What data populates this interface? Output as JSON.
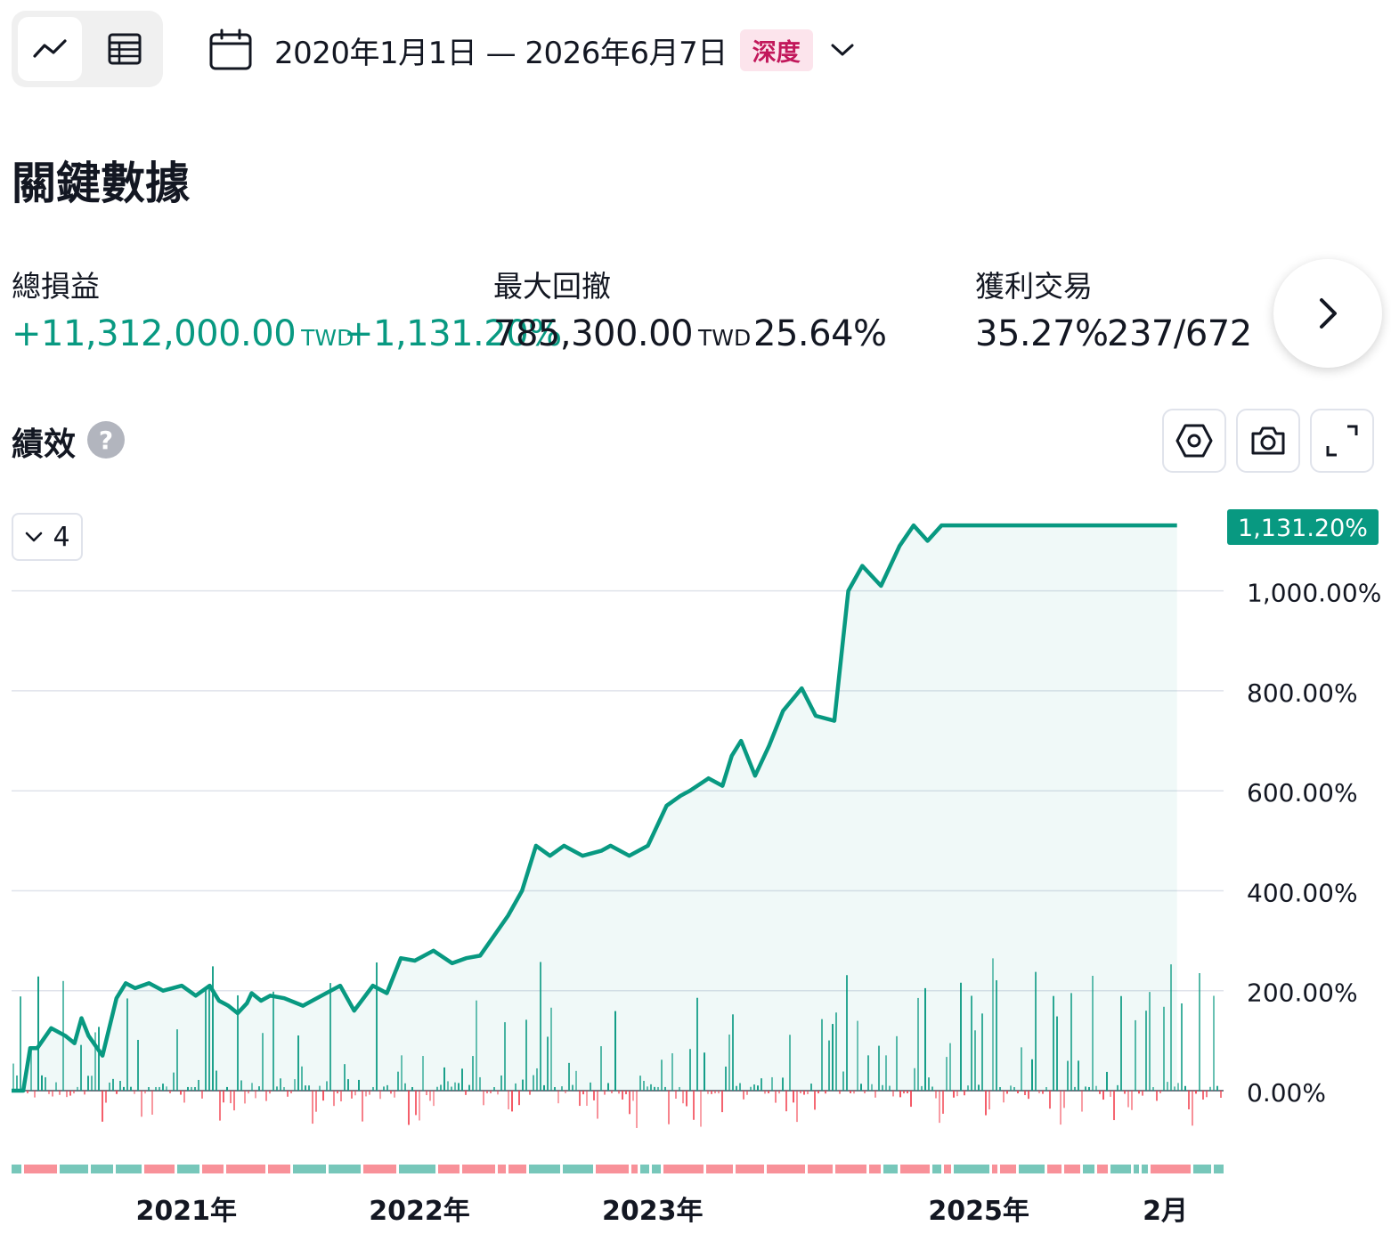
{
  "toolbar": {
    "view_modes": [
      "chart-view",
      "table-view"
    ],
    "date_range": "2020年1月1日 — 2026年6月7日",
    "badge": "深度"
  },
  "section_title": "關鍵數據",
  "metrics": {
    "total_pnl": {
      "label": "總損益",
      "value": "+11,312,000.00",
      "unit": "TWD",
      "percent": "+1,131.20%"
    },
    "max_drawdown": {
      "label": "最大回撤",
      "value": "785,300.00",
      "unit": "TWD",
      "percent": "25.64%"
    },
    "profitable_trades": {
      "label": "獲利交易",
      "percent": "35.27%",
      "ratio": "237/672"
    }
  },
  "performance": {
    "title": "績效",
    "help": "?",
    "series_count": "4"
  },
  "colors": {
    "accent": "#089981",
    "loss": "#f23645",
    "badge_bg": "#fce4ec",
    "badge_fg": "#c2185b",
    "grid": "#e0e3eb"
  },
  "chart_data": {
    "type": "line",
    "current_label": "1,131.20%",
    "y_tick_labels": [
      "1,000.00%",
      "800.00%",
      "600.00%",
      "400.00%",
      "200.00%",
      "0.00%"
    ],
    "y_ticks": [
      1000,
      800,
      600,
      400,
      200,
      0
    ],
    "ylim": [
      0,
      1131.2
    ],
    "x_tick_labels": [
      "2021年",
      "2022年",
      "2023年",
      "2025年",
      "2月"
    ],
    "x_ticks": [
      2021.0,
      2022.0,
      2023.0,
      2024.4,
      2025.2
    ],
    "xlim": [
      2020.25,
      2025.45
    ],
    "series": [
      {
        "x": [
          2020.25,
          2020.3,
          2020.33,
          2020.36,
          2020.42,
          2020.48,
          2020.52,
          2020.55,
          2020.58,
          2020.64,
          2020.7,
          2020.74,
          2020.78,
          2020.84,
          2020.9,
          2020.94,
          2020.98,
          2021.04,
          2021.1,
          2021.14,
          2021.18,
          2021.22,
          2021.26,
          2021.28,
          2021.32,
          2021.36,
          2021.42,
          2021.5,
          2021.58,
          2021.66,
          2021.72,
          2021.8,
          2021.86,
          2021.92,
          2021.98,
          2022.06,
          2022.14,
          2022.2,
          2022.26,
          2022.32,
          2022.38,
          2022.44,
          2022.5,
          2022.56,
          2022.62,
          2022.7,
          2022.78,
          2022.82,
          2022.9,
          2022.98,
          2023.06,
          2023.12,
          2023.16,
          2023.24,
          2023.3,
          2023.34,
          2023.38,
          2023.44,
          2023.5,
          2023.56,
          2023.64,
          2023.7,
          2023.78,
          2023.84,
          2023.9,
          2023.98,
          2024.06,
          2024.12,
          2024.18,
          2024.24,
          2024.28,
          2024.3,
          2024.36,
          2024.42,
          2024.48,
          2024.54,
          2024.6,
          2024.66,
          2024.72,
          2024.78,
          2024.84,
          2024.88,
          2024.92,
          2024.96,
          2025.0,
          2025.04,
          2025.08,
          2025.1,
          2025.11,
          2025.14,
          2025.16,
          2025.18,
          2025.22,
          2025.25
        ],
        "values": [
          0,
          0,
          85,
          85,
          125,
          110,
          95,
          145,
          110,
          70,
          185,
          215,
          205,
          215,
          200,
          205,
          210,
          190,
          210,
          180,
          170,
          155,
          175,
          195,
          180,
          190,
          185,
          170,
          190,
          210,
          160,
          210,
          195,
          265,
          260,
          280,
          255,
          265,
          270,
          310,
          350,
          400,
          490,
          470,
          490,
          470,
          480,
          490,
          470,
          490,
          570,
          590,
          600,
          625,
          610,
          670,
          700,
          630,
          690,
          760,
          805,
          750,
          740,
          1000,
          1050,
          1010,
          1090,
          1131,
          1100,
          1131,
          1131,
          1131,
          1131,
          1131,
          1131,
          1131,
          1131,
          1131,
          1131,
          1131,
          1131,
          1131,
          1131,
          1131,
          1131,
          1131,
          1131,
          1131,
          1131,
          1131,
          1131,
          1131,
          1131,
          1131
        ]
      }
    ]
  }
}
